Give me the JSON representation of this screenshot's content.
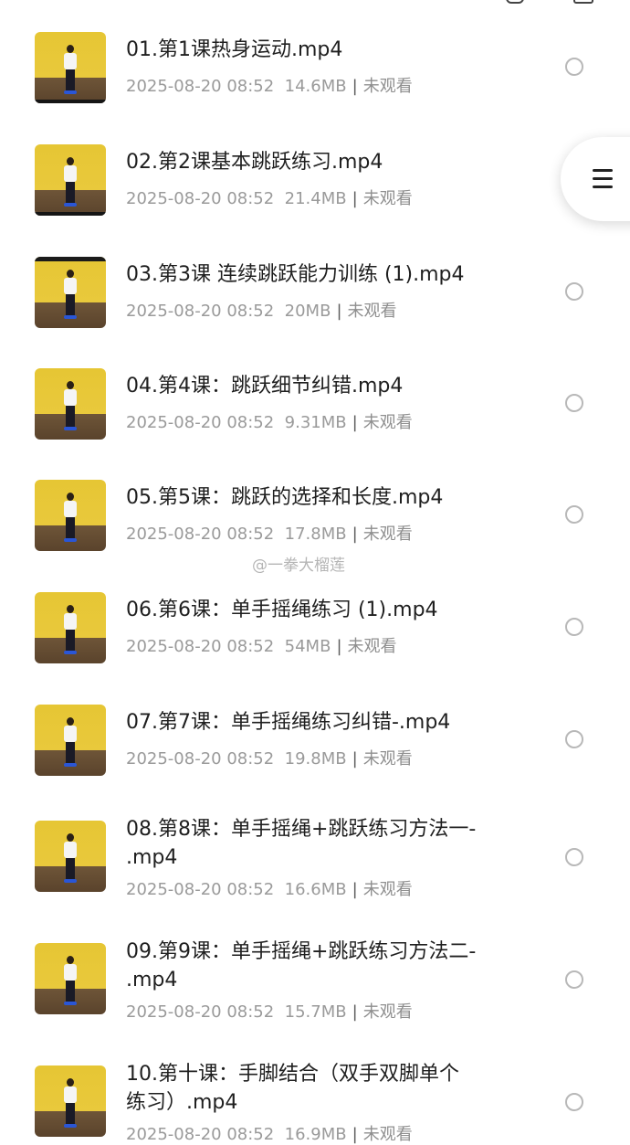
{
  "files": [
    {
      "title": "01.第1课热身运动.mp4",
      "date": "2025-08-20 08:52",
      "size": "14.6MB",
      "status": "未观看"
    },
    {
      "title": "02.第2课基本跳跃练习.mp4",
      "date": "2025-08-20 08:52",
      "size": "21.4MB",
      "status": "未观看"
    },
    {
      "title": "03.第3课 连续跳跃能力训练 (1).mp4",
      "date": "2025-08-20 08:52",
      "size": "20MB",
      "status": "未观看"
    },
    {
      "title": "04.第4课：跳跃细节纠错.mp4",
      "date": "2025-08-20 08:52",
      "size": "9.31MB",
      "status": "未观看"
    },
    {
      "title": "05.第5课：跳跃的选择和长度.mp4",
      "date": "2025-08-20 08:52",
      "size": "17.8MB",
      "status": "未观看"
    },
    {
      "title": "06.第6课：单手摇绳练习 (1).mp4",
      "date": "2025-08-20 08:52",
      "size": "54MB",
      "status": "未观看"
    },
    {
      "title": "07.第7课：单手摇绳练习纠错-.mp4",
      "date": "2025-08-20 08:52",
      "size": "19.8MB",
      "status": "未观看"
    },
    {
      "title": "08.第8课：单手摇绳+跳跃练习方法一-\n.mp4",
      "date": "2025-08-20 08:52",
      "size": "16.6MB",
      "status": "未观看"
    },
    {
      "title": "09.第9课：单手摇绳+跳跃练习方法二-\n.mp4",
      "date": "2025-08-20 08:52",
      "size": "15.7MB",
      "status": "未观看"
    },
    {
      "title": "10.第十课：手脚结合（双手双脚单个\n练习）.mp4",
      "date": "2025-08-20 08:52",
      "size": "16.9MB",
      "status": "未观看"
    }
  ],
  "watermark": "@一拳大榴莲",
  "colors": {
    "thumb_bg": "#e6c634",
    "floor": "#6e5538",
    "meta_text": "#9a9a9a"
  },
  "icons": {
    "side_menu": "hamburger-icon",
    "selection": "radio-circle-icon"
  }
}
